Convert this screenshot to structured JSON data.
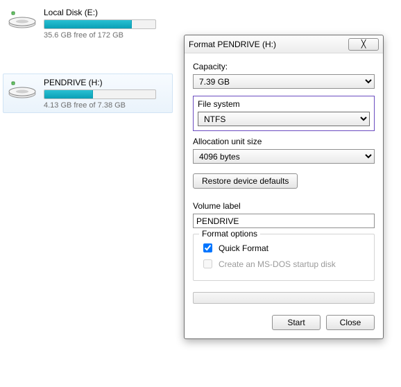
{
  "drives": [
    {
      "name": "Local Disk (E:)",
      "free_text": "35.6 GB free of 172 GB",
      "fill_pct": 79
    },
    {
      "name": "PENDRIVE (H:)",
      "free_text": "4.13 GB free of 7.38 GB",
      "fill_pct": 44
    }
  ],
  "dialog": {
    "title": "Format PENDRIVE (H:)",
    "close_glyph": "╳",
    "capacity_label": "Capacity:",
    "capacity_value": "7.39 GB",
    "filesystem_label": "File system",
    "filesystem_value": "NTFS",
    "alloc_label": "Allocation unit size",
    "alloc_value": "4096 bytes",
    "restore_label": "Restore device defaults",
    "volume_label_label": "Volume label",
    "volume_label_value": "PENDRIVE",
    "format_options_label": "Format options",
    "quick_format_label": "Quick Format",
    "quick_format_checked": true,
    "msdos_label": "Create an MS-DOS startup disk",
    "msdos_checked": false,
    "start_label": "Start",
    "close_label": "Close"
  }
}
